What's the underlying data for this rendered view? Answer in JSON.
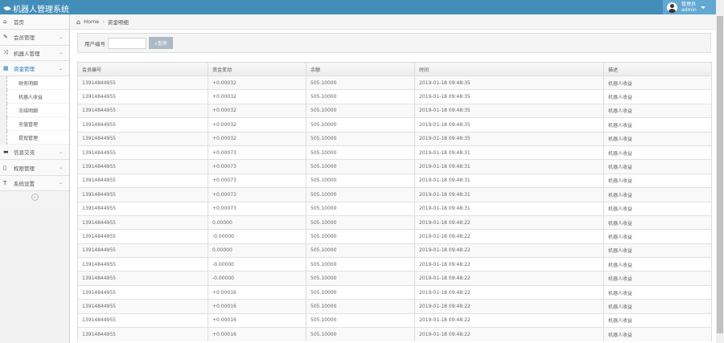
{
  "app": {
    "title": "机器人管理系统"
  },
  "user": {
    "role": "管理员",
    "name": "admin"
  },
  "sidebar": {
    "items": [
      {
        "label": "首页",
        "icon": "⌂"
      },
      {
        "label": "会员管理",
        "icon": "✎"
      },
      {
        "label": "机器人管理",
        "icon": "⤨"
      },
      {
        "label": "资金管理",
        "icon": "▦"
      },
      {
        "label": "信息交流",
        "icon": "▬"
      },
      {
        "label": "权限管理",
        "icon": "▯"
      },
      {
        "label": "系统设置",
        "icon": "T"
      }
    ],
    "subitems": [
      "财务明细",
      "机器人收益",
      "冻结明细",
      "充值管理",
      "提现管理"
    ]
  },
  "breadcrumb": {
    "home": "Home",
    "current": "资金明细"
  },
  "search": {
    "label": "用户编号",
    "value": "",
    "button": "查询"
  },
  "table": {
    "headers": [
      "会员编号",
      "资金变动",
      "余额",
      "时间",
      "描述"
    ],
    "rows": [
      [
        "13914844955",
        "+0.00032",
        "505.10000",
        "2019-01-18 09:48:35",
        "机器人收益"
      ],
      [
        "13914844955",
        "+0.00032",
        "505.10000",
        "2019-01-18 09:48:35",
        "机器人收益"
      ],
      [
        "13914844955",
        "+0.00032",
        "505.10000",
        "2019-01-18 09:48:35",
        "机器人收益"
      ],
      [
        "13914844955",
        "+0.00032",
        "505.10000",
        "2019-01-18 09:48:35",
        "机器人收益"
      ],
      [
        "13914844955",
        "+0.00032",
        "505.10000",
        "2019-01-18 09:48:35",
        "机器人收益"
      ],
      [
        "13914844955",
        "+0.00073",
        "505.10000",
        "2019-01-18 09:48:31",
        "机器人收益"
      ],
      [
        "13914844955",
        "+0.00073",
        "505.10000",
        "2019-01-18 09:48:31",
        "机器人收益"
      ],
      [
        "13914844955",
        "+0.00073",
        "505.10000",
        "2019-01-18 09:48:31",
        "机器人收益"
      ],
      [
        "13914844955",
        "+0.00073",
        "505.10000",
        "2019-01-18 09:48:31",
        "机器人收益"
      ],
      [
        "13914844955",
        "+0.00073",
        "505.10000",
        "2019-01-18 09:48:31",
        "机器人收益"
      ],
      [
        "13914844955",
        "0.00000",
        "505.10000",
        "2019-01-18 09:48:22",
        "机器人收益"
      ],
      [
        "13914844955",
        "-0.00000",
        "505.10000",
        "2019-01-18 09:48:22",
        "机器人收益"
      ],
      [
        "13914844955",
        "0.00000",
        "505.10000",
        "2019-01-18 09:48:22",
        "机器人收益"
      ],
      [
        "13914844955",
        "-0.00000",
        "505.10000",
        "2019-01-18 09:48:22",
        "机器人收益"
      ],
      [
        "13914844955",
        "-0.00000",
        "505.10000",
        "2019-01-18 09:48:22",
        "机器人收益"
      ],
      [
        "13914844955",
        "+0.00016",
        "505.10000",
        "2019-01-18 09:48:22",
        "机器人收益"
      ],
      [
        "13914844955",
        "+0.00016",
        "505.10000",
        "2019-01-18 09:48:22",
        "机器人收益"
      ],
      [
        "13914844955",
        "+0.00016",
        "505.10000",
        "2019-01-18 09:48:22",
        "机器人收益"
      ],
      [
        "13914844955",
        "+0.00016",
        "505.10000",
        "2019-01-18 09:48:22",
        "机器人收益"
      ]
    ]
  }
}
